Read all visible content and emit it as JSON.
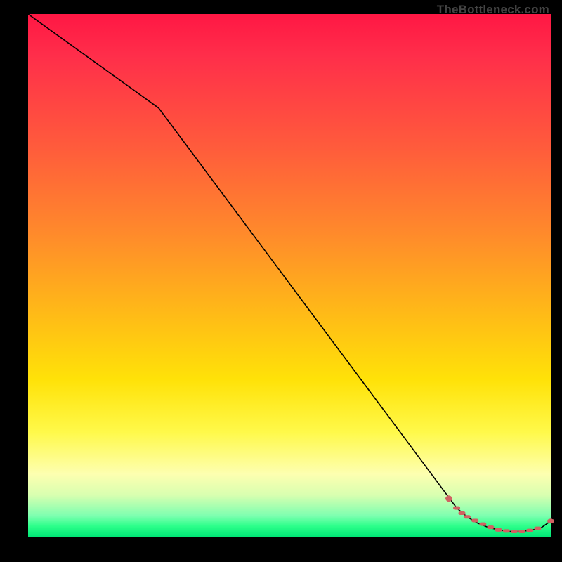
{
  "source_label": "TheBottleneck.com",
  "chart_data": {
    "type": "line",
    "title": "",
    "xlabel": "",
    "ylabel": "",
    "xlim": [
      0,
      100
    ],
    "ylim": [
      0,
      100
    ],
    "series": [
      {
        "name": "bottleneck-curve",
        "x": [
          0,
          25,
          82,
          84,
          86,
          88,
          90,
          92,
          94,
          96,
          98,
          100
        ],
        "values": [
          100,
          82,
          5.5,
          3.8,
          2.6,
          1.8,
          1.3,
          1.0,
          1.0,
          1.2,
          1.6,
          3.0
        ]
      }
    ],
    "markers": {
      "name": "highlighted-points",
      "color": "#d06262",
      "x": [
        80.5,
        82.0,
        83.0,
        84.0,
        85.5,
        87.0,
        88.5,
        90.0,
        91.5,
        93.0,
        94.5,
        96.0,
        97.5,
        100.0
      ],
      "values": [
        7.3,
        5.5,
        4.5,
        3.8,
        3.1,
        2.4,
        1.8,
        1.3,
        1.1,
        1.0,
        1.0,
        1.2,
        1.6,
        3.0
      ]
    }
  },
  "colors": {
    "line": "#000000",
    "marker": "#d06262",
    "background_top": "#ff1744",
    "background_bottom": "#00e676"
  }
}
